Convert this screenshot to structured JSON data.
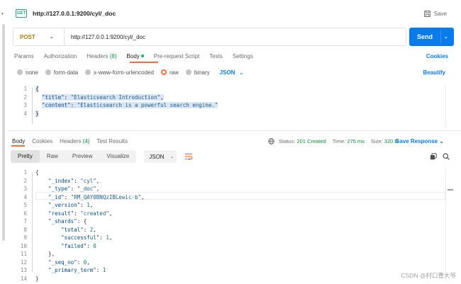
{
  "app": {
    "icon_text": "GET",
    "title": "http://127.0.0.1:9200/cyl/_doc",
    "save_label": "Save"
  },
  "request": {
    "method": "POST",
    "url": "http://127.0.0.1:9200/cyl/_doc",
    "send_label": "Send",
    "tabs": [
      {
        "label": "Params"
      },
      {
        "label": "Authorization"
      },
      {
        "label": "Headers",
        "count": "(8)"
      },
      {
        "label": "Body"
      },
      {
        "label": "Pre-request Script"
      },
      {
        "label": "Tests"
      },
      {
        "label": "Settings"
      }
    ],
    "cookies_label": "Cookies",
    "body_types": [
      "none",
      "form-data",
      "x-www-form-urlencoded",
      "raw",
      "binary"
    ],
    "body_format": "JSON",
    "beautify_label": "Beautify",
    "body_lines": [
      [
        {
          "t": "{",
          "c": "punc"
        }
      ],
      [
        {
          "t": "  ",
          "c": "punc"
        },
        {
          "t": "\"title\"",
          "c": "key"
        },
        {
          "t": ": ",
          "c": "punc"
        },
        {
          "t": "\"Elasticsearch Introduction\"",
          "c": "str"
        },
        {
          "t": ",",
          "c": "punc"
        }
      ],
      [
        {
          "t": "  ",
          "c": "punc"
        },
        {
          "t": "\"content\"",
          "c": "key"
        },
        {
          "t": ": ",
          "c": "punc"
        },
        {
          "t": "\"Elasticsearch is a powerful search engine.\"",
          "c": "str"
        }
      ],
      [
        {
          "t": "}",
          "c": "punc"
        }
      ]
    ]
  },
  "response": {
    "tabs": [
      {
        "label": "Body"
      },
      {
        "label": "Cookies"
      },
      {
        "label": "Headers",
        "count": "(4)"
      },
      {
        "label": "Test Results"
      }
    ],
    "status_label": "Status:",
    "status_value": "201 Created",
    "time_label": "Time:",
    "time_value": "275 ms",
    "size_label": "Size:",
    "size_value": "320 B",
    "save_response_label": "Save Response",
    "views": [
      "Pretty",
      "Raw",
      "Preview",
      "Visualize"
    ],
    "format": "JSON",
    "lines": [
      [
        {
          "t": "{",
          "c": "punc"
        }
      ],
      [
        {
          "t": "    ",
          "c": "punc"
        },
        {
          "t": "\"_index\"",
          "c": "key"
        },
        {
          "t": ": ",
          "c": "punc"
        },
        {
          "t": "\"cyl\"",
          "c": "str"
        },
        {
          "t": ",",
          "c": "punc"
        }
      ],
      [
        {
          "t": "    ",
          "c": "punc"
        },
        {
          "t": "\"_type\"",
          "c": "key"
        },
        {
          "t": ": ",
          "c": "punc"
        },
        {
          "t": "\"_doc\"",
          "c": "str"
        },
        {
          "t": ",",
          "c": "punc"
        }
      ],
      [
        {
          "t": "    ",
          "c": "punc"
        },
        {
          "t": "\"_id\"",
          "c": "key"
        },
        {
          "t": ": ",
          "c": "punc"
        },
        {
          "t": "\"RM_QAY0BNQzIBLewic-b\"",
          "c": "str"
        },
        {
          "t": ",",
          "c": "punc"
        }
      ],
      [
        {
          "t": "    ",
          "c": "punc"
        },
        {
          "t": "\"_version\"",
          "c": "key"
        },
        {
          "t": ": ",
          "c": "punc"
        },
        {
          "t": "1",
          "c": "num"
        },
        {
          "t": ",",
          "c": "punc"
        }
      ],
      [
        {
          "t": "    ",
          "c": "punc"
        },
        {
          "t": "\"result\"",
          "c": "key"
        },
        {
          "t": ": ",
          "c": "punc"
        },
        {
          "t": "\"created\"",
          "c": "str"
        },
        {
          "t": ",",
          "c": "punc"
        }
      ],
      [
        {
          "t": "    ",
          "c": "punc"
        },
        {
          "t": "\"_shards\"",
          "c": "key"
        },
        {
          "t": ": {",
          "c": "punc"
        }
      ],
      [
        {
          "t": "        ",
          "c": "punc"
        },
        {
          "t": "\"total\"",
          "c": "key"
        },
        {
          "t": ": ",
          "c": "punc"
        },
        {
          "t": "2",
          "c": "num"
        },
        {
          "t": ",",
          "c": "punc"
        }
      ],
      [
        {
          "t": "        ",
          "c": "punc"
        },
        {
          "t": "\"successful\"",
          "c": "key"
        },
        {
          "t": ": ",
          "c": "punc"
        },
        {
          "t": "1",
          "c": "num"
        },
        {
          "t": ",",
          "c": "punc"
        }
      ],
      [
        {
          "t": "        ",
          "c": "punc"
        },
        {
          "t": "\"failed\"",
          "c": "key"
        },
        {
          "t": ": ",
          "c": "punc"
        },
        {
          "t": "0",
          "c": "num"
        }
      ],
      [
        {
          "t": "    },",
          "c": "punc"
        }
      ],
      [
        {
          "t": "    ",
          "c": "punc"
        },
        {
          "t": "\"_seq_no\"",
          "c": "key"
        },
        {
          "t": ": ",
          "c": "punc"
        },
        {
          "t": "0",
          "c": "num"
        },
        {
          "t": ",",
          "c": "punc"
        }
      ],
      [
        {
          "t": "    ",
          "c": "punc"
        },
        {
          "t": "\"_primary_term\"",
          "c": "key"
        },
        {
          "t": ": ",
          "c": "punc"
        },
        {
          "t": "1",
          "c": "num"
        }
      ],
      [
        {
          "t": "}",
          "c": "punc"
        }
      ]
    ]
  },
  "watermark": "CSDN @村口曹大爷",
  "colors": {
    "accent": "#ff6c37",
    "primary": "#097bed",
    "success": "#0f8b3a",
    "method": "#b07c00"
  }
}
